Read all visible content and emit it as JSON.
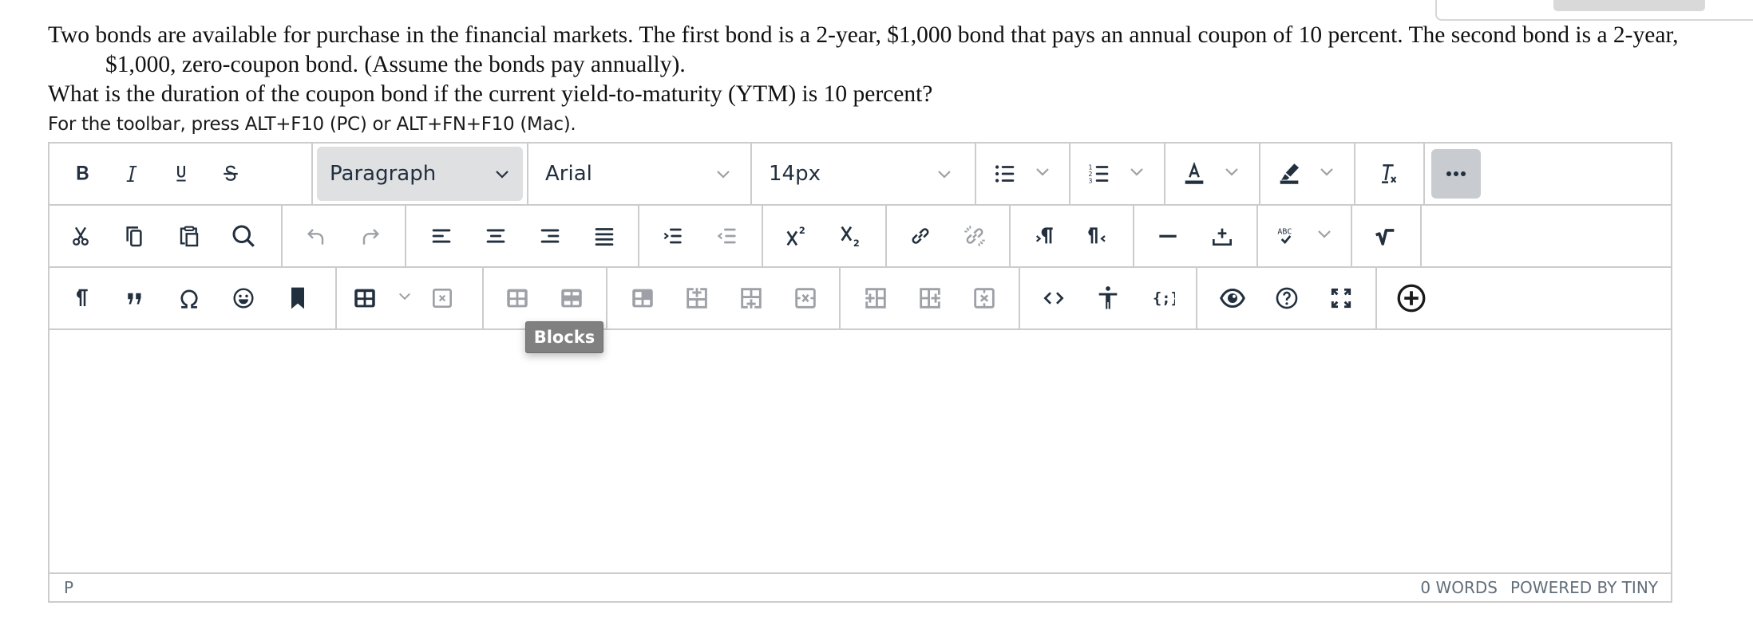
{
  "question": {
    "line1": "Two bonds are available for purchase in the financial markets.  The first bond is a 2-year, $1,000 bond that pays an annual coupon of 10 percent.  The second bond is a 2-year, $1,000, zero-coupon bond. (Assume the bonds pay annually).",
    "line2": "What is the duration of the coupon bond if the current yield-to-maturity (YTM) is 10 percent?"
  },
  "hint": "For the toolbar, press ALT+F10 (PC) or ALT+FN+F10 (Mac).",
  "toolbar": {
    "blocks_value": "Paragraph",
    "font_value": "Arial",
    "size_value": "14px",
    "tooltip": "Blocks",
    "row1": [
      "bold",
      "italic",
      "underline",
      "strikethrough",
      "blocks",
      "font-family",
      "font-size",
      "bullet-list",
      "numbered-list",
      "text-color",
      "highlight-color",
      "clear-formatting",
      "more"
    ],
    "row2": [
      "cut",
      "copy",
      "paste",
      "find-replace",
      "undo",
      "redo",
      "align-left",
      "align-center",
      "align-right",
      "justify",
      "indent",
      "outdent",
      "superscript",
      "subscript",
      "link",
      "unlink",
      "ltr",
      "rtl",
      "horizontal-rule",
      "insert-template",
      "spellcheck",
      "math-equation"
    ],
    "row3": [
      "show-blocks",
      "blockquote",
      "special-character",
      "emoticons",
      "bookmark",
      "table",
      "delete-table",
      "table-row-props",
      "table-cell-props",
      "merge-cells",
      "insert-row-before",
      "insert-row-after",
      "delete-row",
      "insert-col-before",
      "insert-col-after",
      "delete-col",
      "source-code",
      "accessibility-checker",
      "code-sample",
      "preview",
      "help",
      "fullscreen",
      "add-content"
    ]
  },
  "statusbar": {
    "path": "P",
    "word_count": "0 WORDS",
    "branding": "POWERED BY TINY"
  },
  "colors": {
    "icon": "#222f3e",
    "icon_disabled": "#9da0a6",
    "border": "#cccccc",
    "blocks_bg": "#dee0e2",
    "more_bg": "#c8cbcf",
    "tooltip_bg": "#808080"
  }
}
